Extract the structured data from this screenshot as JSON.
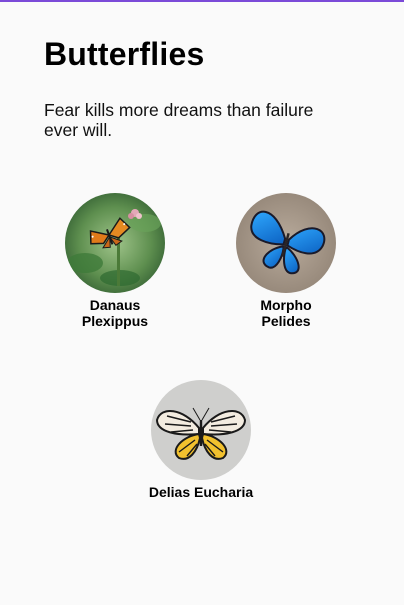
{
  "page": {
    "title": "Butterflies",
    "quote": "Fear kills more dreams than failure ever will."
  },
  "butterflies": [
    {
      "name_line1": "Danaus",
      "name_line2": "Plexippus",
      "icon": "orange-butterfly-photo"
    },
    {
      "name_line1": "Morpho",
      "name_line2": "Pelides",
      "icon": "blue-butterfly-photo"
    },
    {
      "name_line1": "Delias Eucharia",
      "icon": "yellow-butterfly-photo"
    }
  ],
  "colors": {
    "accent": "#7b4ad8",
    "background": "#fafafa",
    "text": "#000000"
  }
}
